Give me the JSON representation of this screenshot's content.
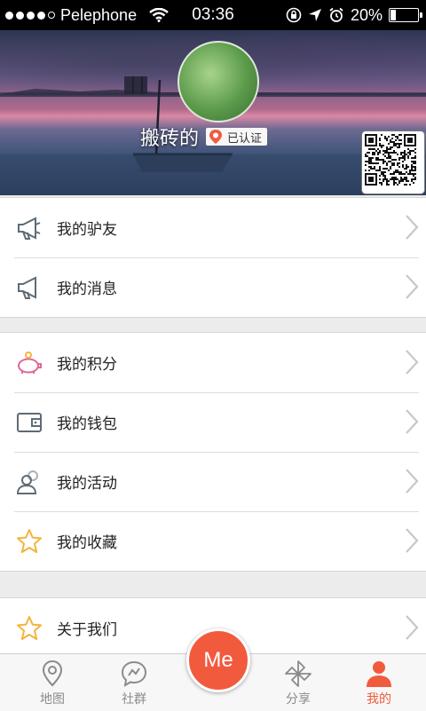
{
  "status_bar": {
    "signal_bars_filled": 4,
    "signal_bars_total": 5,
    "carrier": "Pelephone",
    "time": "03:36",
    "battery_text": "20%",
    "battery_level": 0.2
  },
  "profile": {
    "username": "搬砖的",
    "verified_text": "已认证"
  },
  "menu": {
    "group1": [
      {
        "label": "我的驴友",
        "icon": "megaphone-icon"
      },
      {
        "label": "我的消息",
        "icon": "megaphone-icon"
      }
    ],
    "group2": [
      {
        "label": "我的积分",
        "icon": "piggy-bank-icon"
      },
      {
        "label": "我的钱包",
        "icon": "wallet-icon"
      },
      {
        "label": "我的活动",
        "icon": "people-icon"
      },
      {
        "label": "我的收藏",
        "icon": "star-icon"
      }
    ],
    "group3": [
      {
        "label": "关于我们",
        "icon": "star-icon"
      }
    ]
  },
  "tabbar": {
    "tabs": [
      {
        "label": "地图",
        "icon": "map-pin-icon"
      },
      {
        "label": "社群",
        "icon": "chat-bubble-icon"
      },
      {
        "label": "分享",
        "icon": "pinwheel-icon"
      },
      {
        "label": "我的",
        "icon": "person-icon"
      }
    ],
    "center_button": "Me",
    "active_tab": "我的"
  },
  "colors": {
    "accent": "#f25a3e",
    "icon_gray": "#5f6b74",
    "star": "#f3b33d",
    "piggy": "#e2679a"
  }
}
